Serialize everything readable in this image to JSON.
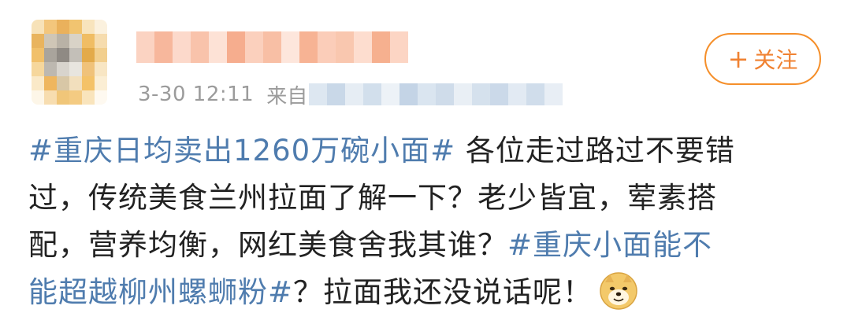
{
  "header": {
    "time": "3-30 12:11",
    "source_prefix": "来自",
    "follow_label": "关注",
    "follow_icon": "plus-icon"
  },
  "post": {
    "lines": [
      [
        {
          "type": "tag",
          "text": "#重庆日均卖出1260万碗小面#"
        },
        {
          "type": "text",
          "text": " 各位走过路过不要错"
        }
      ],
      [
        {
          "type": "text",
          "text": "过，传统美食兰州拉面了解一下？老少皆宜，荤素搭"
        }
      ],
      [
        {
          "type": "text",
          "text": "配，营养均衡，网红美食舍我其谁？"
        },
        {
          "type": "tag",
          "text": "#重庆小面能不"
        }
      ],
      [
        {
          "type": "tag",
          "text": "能超越柳州螺蛳粉#"
        },
        {
          "type": "text",
          "text": "？拉面我还没说话呢！"
        },
        {
          "type": "emoji",
          "name": "doge-emoji"
        }
      ]
    ]
  },
  "colors": {
    "tag": "#4f7cae",
    "text": "#222222",
    "meta": "#9b9b9b",
    "follow": "#f08232"
  }
}
